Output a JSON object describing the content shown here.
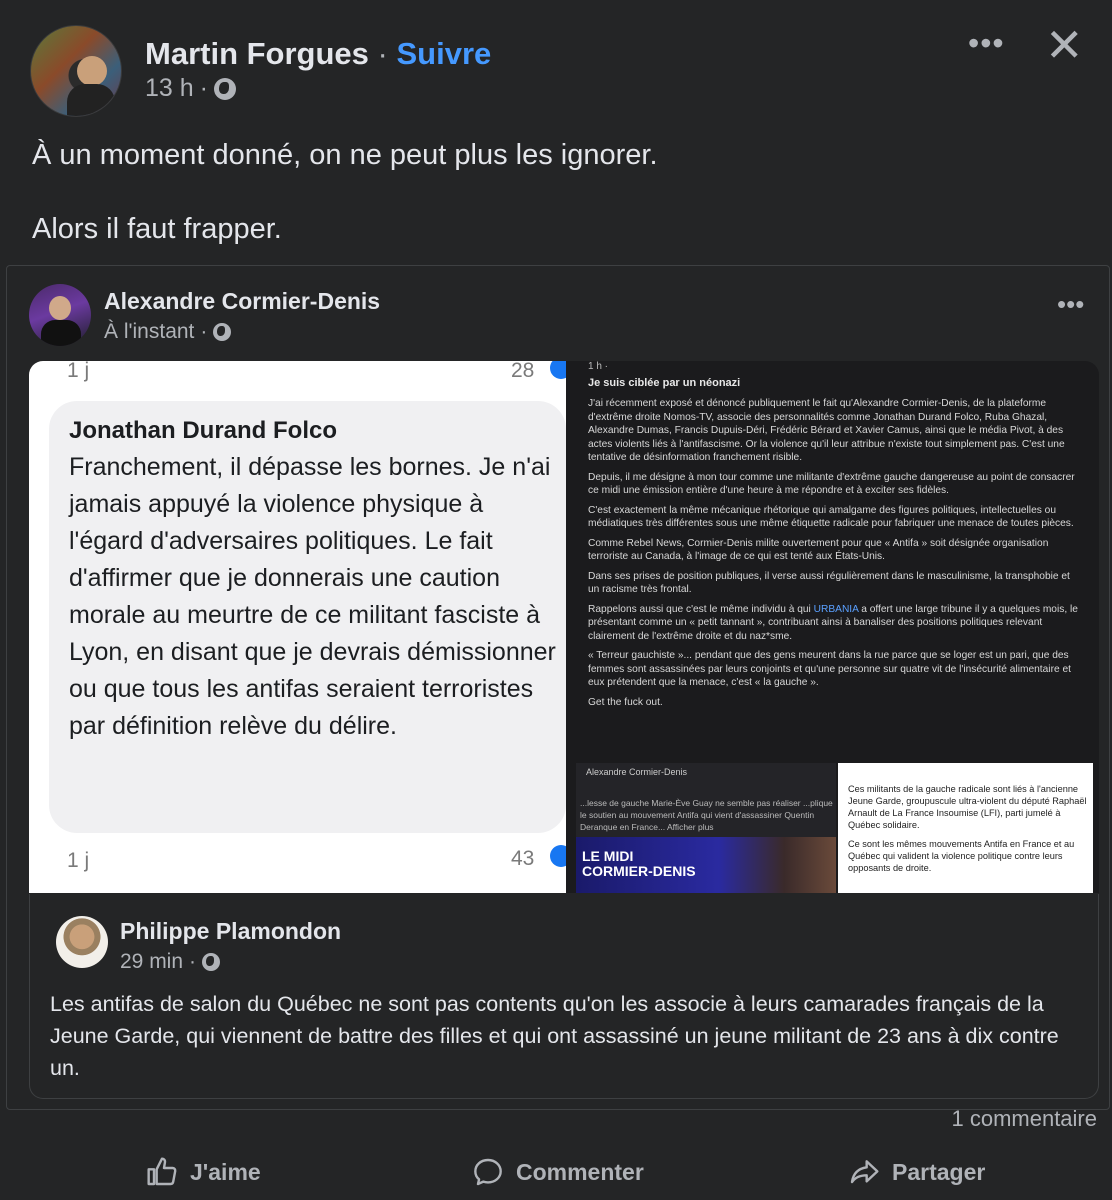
{
  "post": {
    "author": "Martin Forgues",
    "separator": "·",
    "follow_label": "Suivre",
    "time": "13 h",
    "time_sep": "·",
    "more_label": "•••",
    "close_label": "✕",
    "text_line1": "À un moment donné, on ne peut plus les ignorer.",
    "text_line2": "Alors il faut frapper."
  },
  "shared": {
    "author": "Alexandre Cormier-Denis",
    "time": "À l'instant",
    "time_sep": "·",
    "more_label": "•••",
    "screenshot_left": {
      "top_time": "1 j",
      "top_count": "28",
      "name": "Jonathan Durand Folco",
      "text": "Franchement, il dépasse les bornes. Je n'ai jamais appuyé la violence physique à l'égard d'adversaires politiques. Le fait d'affirmer que je donnerais une caution morale au meurtre de ce militant fasciste à Lyon, en disant que je devrais démissionner ou que tous les antifas seraient terroristes par définition relève du délire.",
      "bottom_time": "1 j",
      "bottom_count": "43"
    },
    "screenshot_right": {
      "head": "1 h ·",
      "title": "Je suis ciblée par un néonazi",
      "p1": "J'ai récemment exposé et dénoncé publiquement le fait qu'Alexandre Cormier-Denis, de la plateforme d'extrême droite Nomos-TV, associe des personnalités comme Jonathan Durand Folco, Ruba Ghazal, Alexandre Dumas, Francis Dupuis-Déri, Frédéric Bérard et Xavier Camus, ainsi que le média Pivot, à des actes violents liés à l'antifascisme. Or la violence qu'il leur attribue n'existe tout simplement pas. C'est une tentative de désinformation franchement risible.",
      "p2": "Depuis, il me désigne à mon tour comme une militante d'extrême gauche dangereuse au point de consacrer ce midi une émission entière d'une heure à me répondre et à exciter ses fidèles.",
      "p3": "C'est exactement la même mécanique rhétorique qui amalgame des figures politiques, intellectuelles ou médiatiques très différentes sous une même étiquette radicale pour fabriquer une menace de toutes pièces.",
      "p4": "Comme Rebel News, Cormier-Denis milite ouvertement pour que « Antifa » soit désignée organisation terroriste au Canada, à l'image de ce qui est tenté aux États-Unis.",
      "p5": "Dans ses prises de position publiques, il verse aussi régulièrement dans le masculinisme, la transphobie et un racisme très frontal.",
      "p6_a": "Rappelons aussi que c'est le même individu à qui ",
      "p6_hl": "URBANIA",
      "p6_b": " a offert une large tribune il y a quelques mois, le présentant comme un « petit tannant », contribuant ainsi à banaliser des positions politiques relevant clairement de l'extrême droite et du naz*sme.",
      "p7": "« Terreur gauchiste »... pendant que des gens meurent dans la rue parce que se loger est un pari, que des femmes sont assassinées par leurs conjoints et qu'une personne sur quatre vit de l'insécurité alimentaire et eux prétendent que la menace, c'est « la gauche ».",
      "p8": "Get the fuck out.",
      "quote_name": "Alexandre Cormier-Denis",
      "quote_text": "...lesse de gauche Marie-Ève Guay ne semble pas réaliser ...plique le soutien au mouvement Antifa qui vient d'assassiner Quentin Deranque en France... Afficher plus",
      "banner": "LE MIDI\nCORMIER-DENIS",
      "white_p1": "Ces militants de la gauche radicale sont liés à l'ancienne Jeune Garde, groupuscule ultra-violent du député Raphaël Arnault de La France Insoumise (LFI), parti jumelé à Québec solidaire.",
      "white_p2": "Ce sont les mêmes mouvements Antifa en France et au Québec qui valident la violence politique contre leurs opposants de droite."
    },
    "comment": {
      "author": "Philippe Plamondon",
      "time": "29 min",
      "time_sep": "·",
      "text": "Les antifas de salon du Québec ne sont pas contents qu'on les associe à leurs camarades français de la Jeune Garde, qui viennent de battre des filles et qui ont assassiné un jeune militant de 23 ans à dix contre un."
    }
  },
  "footer": {
    "comments_count": "1 commentaire",
    "like_label": "J'aime",
    "comment_label": "Commenter",
    "share_label": "Partager"
  },
  "icons": {
    "globe": "globe-icon",
    "like": "thumbs-up-icon",
    "comment": "speech-bubble-icon",
    "share": "share-arrow-icon"
  },
  "colors": {
    "background": "#242526",
    "text": "#e4e6eb",
    "muted": "#b0b3b8",
    "link": "#4599ff"
  }
}
